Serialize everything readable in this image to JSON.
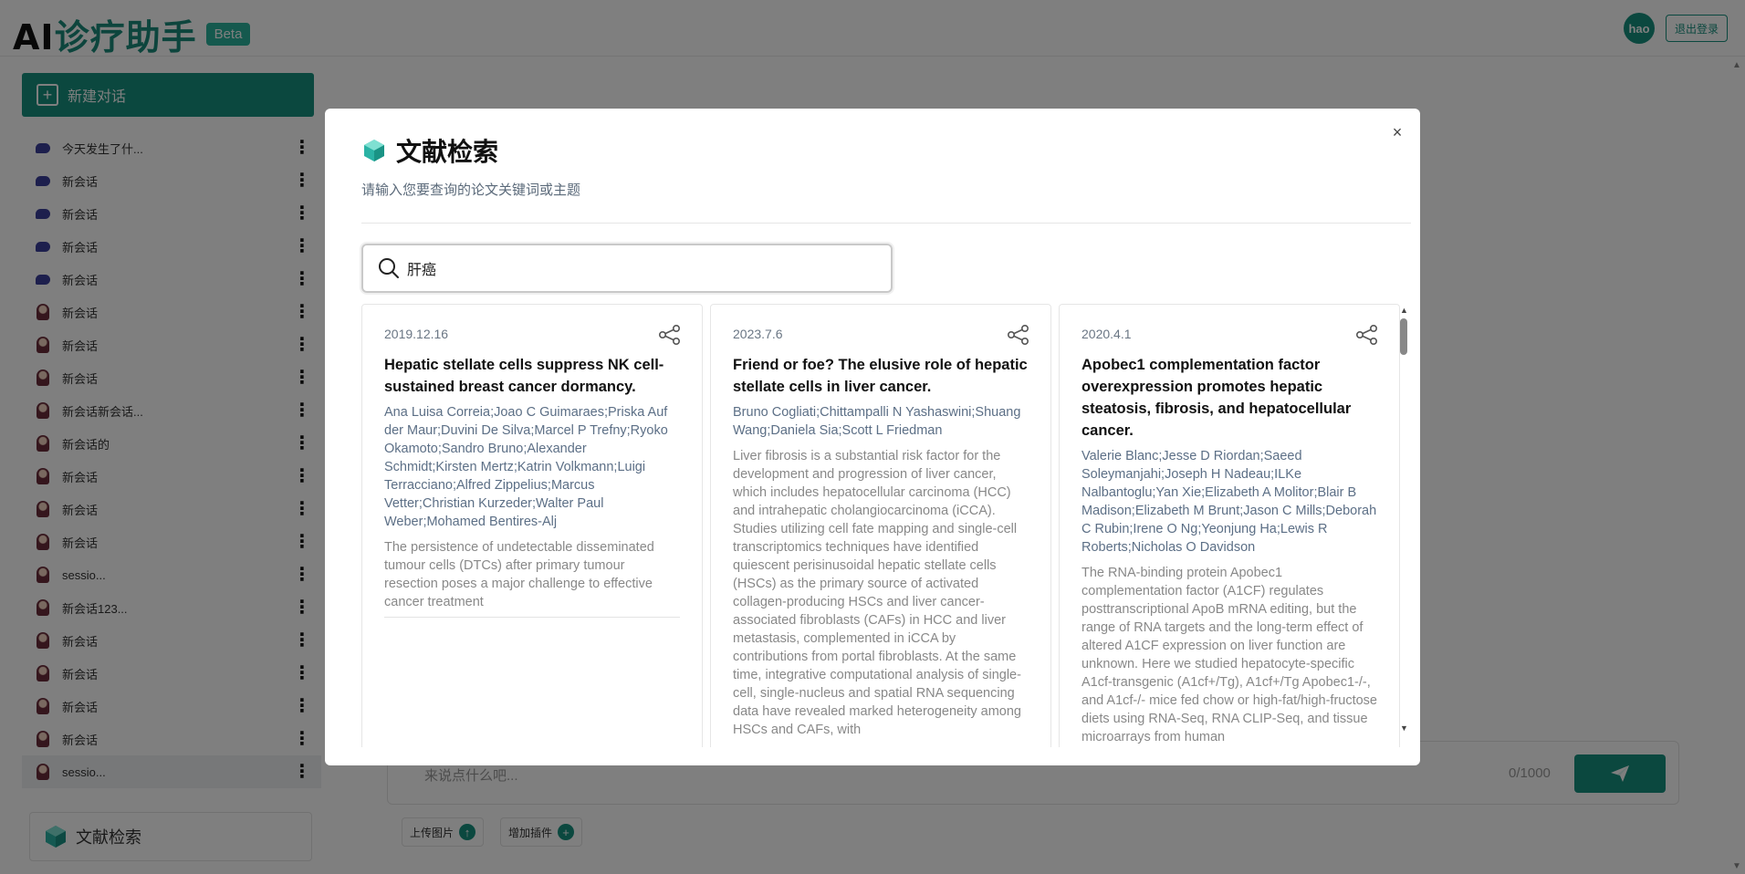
{
  "app": {
    "brand_ai": "AI",
    "brand_rest": "诊疗助手",
    "beta": "Beta",
    "user": "hao",
    "logout": "退出登录"
  },
  "sidebar": {
    "new_chat": "新建对话",
    "sessions": [
      {
        "title": "今天发生了什...",
        "icon": "bubble"
      },
      {
        "title": "新会话",
        "icon": "bubble"
      },
      {
        "title": "新会话",
        "icon": "bubble"
      },
      {
        "title": "新会话",
        "icon": "bubble"
      },
      {
        "title": "新会话",
        "icon": "bubble"
      },
      {
        "title": "新会话",
        "icon": "person"
      },
      {
        "title": "新会话",
        "icon": "person"
      },
      {
        "title": "新会话",
        "icon": "person"
      },
      {
        "title": "新会话新会话...",
        "icon": "person"
      },
      {
        "title": "新会话的",
        "icon": "person"
      },
      {
        "title": "新会话",
        "icon": "person"
      },
      {
        "title": "新会话",
        "icon": "person"
      },
      {
        "title": "新会话",
        "icon": "person"
      },
      {
        "title": "sessio...",
        "icon": "person"
      },
      {
        "title": "新会话123...",
        "icon": "person"
      },
      {
        "title": "新会话",
        "icon": "person"
      },
      {
        "title": "新会话",
        "icon": "person"
      },
      {
        "title": "新会话",
        "icon": "person"
      },
      {
        "title": "新会话",
        "icon": "person"
      },
      {
        "title": "sessio...",
        "icon": "person"
      }
    ],
    "literature_button": "文献检索"
  },
  "composer": {
    "placeholder": "来说点什么吧...",
    "counter": "0/1000",
    "upload_image": "上传图片",
    "add_plugin": "增加插件"
  },
  "modal": {
    "title": "文献检索",
    "subtitle": "请输入您要查询的论文关键词或主题",
    "search_value": "肝癌",
    "close": "×",
    "papers": [
      {
        "date": "2019.12.16",
        "title": "Hepatic stellate cells suppress NK cell-sustained breast cancer dormancy.",
        "authors": "Ana Luisa Correia;Joao C Guimaraes;Priska Auf der Maur;Duvini De Silva;Marcel P Trefny;Ryoko Okamoto;Sandro Bruno;Alexander Schmidt;Kirsten Mertz;Katrin Volkmann;Luigi Terracciano;Alfred Zippelius;Marcus Vetter;Christian Kurzeder;Walter Paul Weber;Mohamed Bentires-Alj",
        "abstract": "The persistence of undetectable disseminated tumour cells (DTCs) after primary tumour resection poses a major challenge to effective cancer treatment"
      },
      {
        "date": "2023.7.6",
        "title": "Friend or foe? The elusive role of hepatic stellate cells in liver cancer.",
        "authors": "Bruno Cogliati;Chittampalli N Yashaswini;Shuang Wang;Daniela Sia;Scott L Friedman",
        "abstract": "Liver fibrosis is a substantial risk factor for the development and progression of liver cancer, which includes hepatocellular carcinoma (HCC) and intrahepatic cholangiocarcinoma (iCCA). Studies utilizing cell fate mapping and single-cell transcriptomics techniques have identified quiescent perisinusoidal hepatic stellate cells (HSCs) as the primary source of activated collagen-producing HSCs and liver cancer-associated fibroblasts (CAFs) in HCC and liver metastasis, complemented in iCCA by contributions from portal fibroblasts. At the same time, integrative computational analysis of single-cell, single-nucleus and spatial RNA sequencing data have revealed marked heterogeneity among HSCs and CAFs, with"
      },
      {
        "date": "2020.4.1",
        "title": "Apobec1 complementation factor overexpression promotes hepatic steatosis, fibrosis, and hepatocellular cancer.",
        "authors": "Valerie Blanc;Jesse D Riordan;Saeed Soleymanjahi;Joseph H Nadeau;ILKe Nalbantoglu;Yan Xie;Elizabeth A Molitor;Blair B Madison;Elizabeth M Brunt;Jason C Mills;Deborah C Rubin;Irene O Ng;Yeonjung Ha;Lewis R Roberts;Nicholas O Davidson",
        "abstract": "The RNA-binding protein Apobec1 complementation factor (A1CF) regulates posttranscriptional ApoB mRNA editing, but the range of RNA targets and the long-term effect of altered A1CF expression on liver function are unknown. Here we studied hepatocyte-specific A1cf-transgenic (A1cf+/Tg), A1cf+/Tg Apobec1-/-, and A1cf-/- mice fed chow or high-fat/high-fructose diets using RNA-Seq, RNA CLIP-Seq, and tissue microarrays from human"
      }
    ]
  },
  "colors": {
    "accent": "#17907f",
    "overlay": "rgba(0,0,0,0.5)",
    "author_text": "#5c6f86",
    "abstract_text": "#888888"
  },
  "icons": {
    "share": "share-icon",
    "search": "search-icon",
    "logo": "hexagon-cube-icon",
    "send": "paper-plane-icon"
  }
}
